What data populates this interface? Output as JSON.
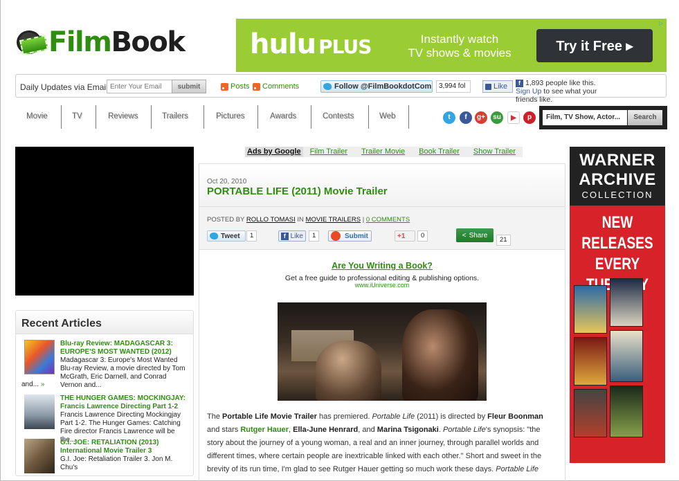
{
  "logo": {
    "film": "Film",
    "book": "Book"
  },
  "hulu_ad": {
    "brand": "hulu",
    "brand_plus": "PLUS",
    "tagline_1": "Instantly watch",
    "tagline_2": "TV shows & movies",
    "cta": "Try it Free ▸"
  },
  "subscribe": {
    "label": "Daily Updates via Email",
    "email_placeholder": "Enter Your Email",
    "submit": "submit",
    "posts": "Posts",
    "comments": "Comments",
    "follow": "Follow @FilmBookdotCom",
    "follow_count": "3,994 fol",
    "like": "Like",
    "fb_people": "1,893 people like this.",
    "fb_signup": "Sign Up",
    "fb_signup_rest": " to see what your friends like."
  },
  "nav": [
    "Movie",
    "TV",
    "Reviews",
    "Trailers",
    "Pictures",
    "Awards",
    "Contests",
    "Web"
  ],
  "social": [
    "twitter-icon",
    "facebook-icon",
    "google-plus-icon",
    "stumbleupon-icon",
    "youtube-icon",
    "pinterest-icon"
  ],
  "search": {
    "placeholder": "Film, TV Show, Actor...",
    "button": "Search"
  },
  "ads_by_google": {
    "label": "Ads by Google",
    "links": [
      "Film Trailer",
      "Trailer Movie",
      "Book Trailer",
      "Show Trailer"
    ]
  },
  "recent": {
    "heading": "Recent Articles",
    "items": [
      {
        "title": "Blu-ray Review: MADAGASCAR 3: EUROPE'S MOST WANTED (2012)",
        "desc": "Madagascar 3: Europe's Most Wanted Blu-ray Review, a movie directed by Tom McGrath, Eric Darnell, and Conrad Vernon and...",
        "more": "»"
      },
      {
        "title": "THE HUNGER GAMES: MOCKINGJAY: Francis Lawrence Directing Part 1-2",
        "desc": "Francis Lawrence Directing Mockingjay Part 1-2. The Hunger Games: Catching Fire director Francis Lawrence will be the...",
        "more": "»"
      },
      {
        "title": "G.I. JOE: RETALIATION (2013) International Movie Trailer 3",
        "desc": "G.I. Joe: Retaliation Trailer 3. Jon M. Chu's"
      }
    ]
  },
  "post": {
    "date": "Oct 20, 2010",
    "title": "PORTABLE LIFE (2011) Movie Trailer",
    "posted_by": "POSTED BY",
    "author": "ROLLO TOMASI",
    "in": "IN",
    "category": "MOVIE TRAILERS",
    "sep": "|",
    "comments": "0 COMMENTS",
    "tweet": "Tweet",
    "tweet_count": "1",
    "fb_like": "Like",
    "fb_count": "1",
    "submit": "Submit",
    "gplus": "+1",
    "gplus_count": "0",
    "share": "Share",
    "share_count": "21",
    "promo_title": "Are You Writing a Book?",
    "promo_desc": "Get a free guide to professional editing & publishing options.",
    "promo_url": "www.iUniverse.com",
    "para": {
      "t1": "The ",
      "b1": "Portable Life Movie Trailer",
      "t2": " has premiered. ",
      "i1": "Portable Life",
      "t3": " (2011) is directed by ",
      "b2": "Fleur Boonman",
      "t4": " and stars ",
      "b3": "Rutger Hauer",
      "t5": ", ",
      "b4": "Ella-June Henrard",
      "t6": ", and ",
      "b5": "Marina Tsigonaki",
      "t7": ". ",
      "i2": "Portable Life",
      "t8": "'s synopsis: \"the story about the journey of a young woman, a real and an inner journey, through parallel worlds and different times, where certain people are inextricable linked with each other.\" Short and sweet in the brevity of its run time, I'm glad to see Rutger Hauer getting so much work these days. ",
      "i3": "Portable Life"
    }
  },
  "warner_ad": {
    "line1": "WARNER",
    "line2": "ARCHIVE",
    "line3": "COLLECTION",
    "nr1": "NEW RELEASES",
    "nr2": "EVERY TUESDAY"
  }
}
